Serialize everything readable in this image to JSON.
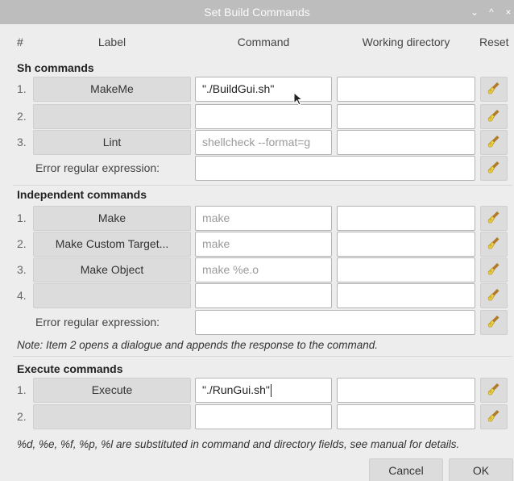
{
  "window": {
    "title": "Set Build Commands",
    "controls": {
      "minimize": "⌄",
      "maximize": "^",
      "close": "×"
    }
  },
  "header": {
    "number": "#",
    "label": "Label",
    "command": "Command",
    "working_directory": "Working directory",
    "reset": "Reset"
  },
  "sh_commands": {
    "title": "Sh commands",
    "rows": [
      {
        "num": "1.",
        "label": "MakeMe",
        "command": "\"./BuildGui.sh\"",
        "command_placeholder": false,
        "dir": ""
      },
      {
        "num": "2.",
        "label": "",
        "command": "",
        "command_placeholder": false,
        "dir": ""
      },
      {
        "num": "3.",
        "label": "Lint",
        "command": "shellcheck --format=g",
        "command_placeholder": true,
        "dir": ""
      }
    ],
    "error_label": "Error regular expression:",
    "error_value": ""
  },
  "independent_commands": {
    "title": "Independent commands",
    "rows": [
      {
        "num": "1.",
        "label": "Make",
        "command": "make",
        "command_placeholder": true,
        "dir": ""
      },
      {
        "num": "2.",
        "label": "Make Custom Target...",
        "command": "make",
        "command_placeholder": true,
        "dir": ""
      },
      {
        "num": "3.",
        "label": "Make Object",
        "command": "make %e.o",
        "command_placeholder": true,
        "dir": ""
      },
      {
        "num": "4.",
        "label": "",
        "command": "",
        "command_placeholder": false,
        "dir": ""
      }
    ],
    "error_label": "Error regular expression:",
    "error_value": "",
    "note": "Note: Item 2 opens a dialogue and appends the response to the command."
  },
  "execute_commands": {
    "title": "Execute commands",
    "rows": [
      {
        "num": "1.",
        "label": "Execute",
        "command": "\"./RunGui.sh\"",
        "command_placeholder": false,
        "dir": ""
      },
      {
        "num": "2.",
        "label": "",
        "command": "",
        "command_placeholder": false,
        "dir": ""
      }
    ]
  },
  "footer_note": "%d, %e, %f, %p, %l are substituted in command and directory fields, see manual for details.",
  "buttons": {
    "cancel": "Cancel",
    "ok": "OK"
  },
  "icons": {
    "reset": "broom-icon",
    "cursor": "mouse-pointer-icon"
  },
  "colors": {
    "titlebar": "#bdbdbd",
    "dialog_bg": "#ededed",
    "button_bg": "#dcdcdc",
    "broom_yellow": "#f0d24a"
  }
}
